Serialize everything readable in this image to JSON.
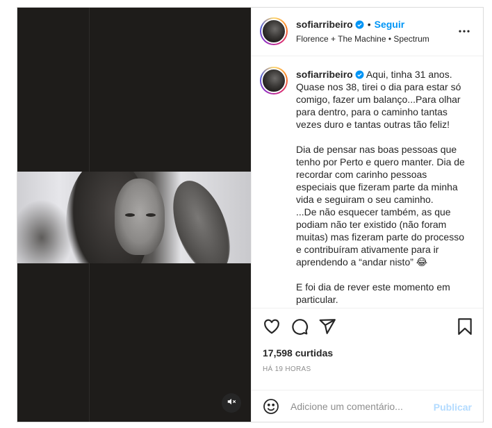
{
  "post": {
    "author": {
      "username": "sofiarribeiro",
      "verified": true,
      "follow_label": "Seguir",
      "separator": "•",
      "audio": "Florence + The Machine • Spectrum"
    },
    "caption": {
      "username": "sofiarribeiro",
      "text": "Aqui, tinha 31 anos. Quase nos 38, tirei o dia para estar só comigo, fazer um balanço...Para olhar para dentro, para o caminho tantas vezes duro e tantas outras tão feliz!\n\nDia de pensar nas boas pessoas que tenho por Perto e quero manter. Dia de recordar com carinho pessoas especiais que fizeram parte da minha vida e seguiram o seu caminho.\n...De não esquecer também, as que podiam não ter existido (não foram muitas) mas fizeram parte do processo e contribuíram ativamente para ir aprendendo a “andar nisto” 😂\n\nE foi dia de rever este momento em particular."
    },
    "likes": "17,598 curtidas",
    "time_ago": "HÁ 19 HORAS",
    "comment": {
      "placeholder": "Adicione um comentário...",
      "publish_label": "Publicar"
    },
    "icons": {
      "more": "more-options-icon",
      "like": "heart-icon",
      "comment": "comment-icon",
      "share": "share-icon",
      "save": "bookmark-icon",
      "emoji": "emoji-icon",
      "mute": "muted-speaker-icon",
      "verified": "verified-badge-icon"
    },
    "colors": {
      "accent": "#0095f6",
      "publish_disabled": "#b3dbff",
      "muted_text": "#8e8e8e"
    }
  }
}
